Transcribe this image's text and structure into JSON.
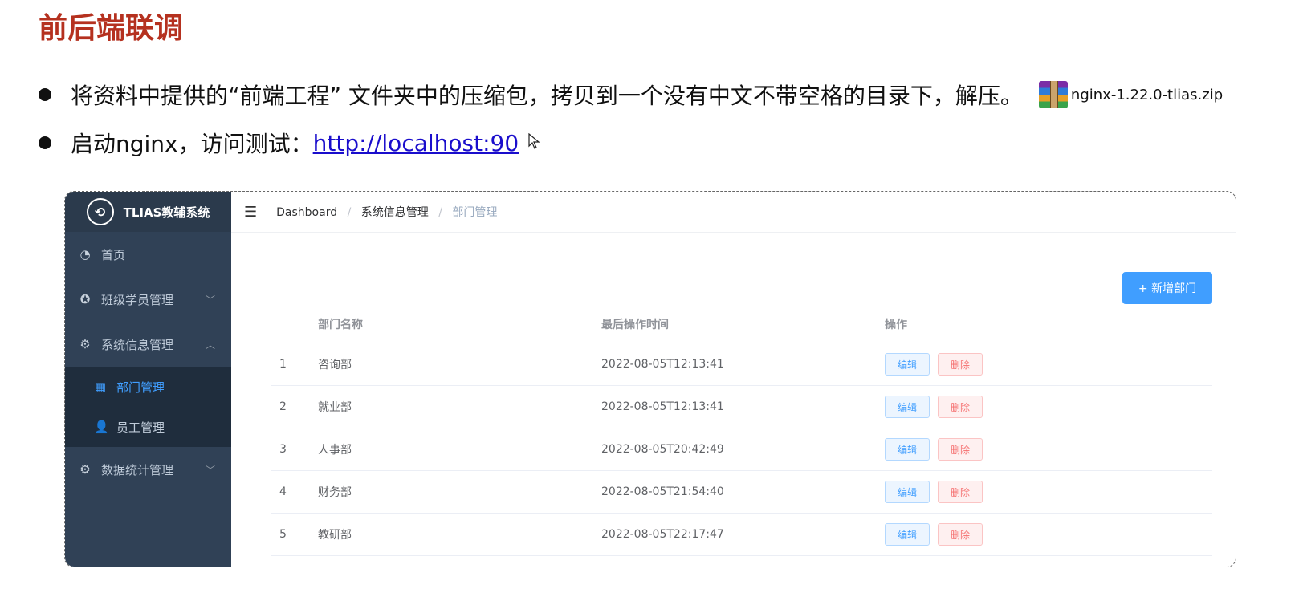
{
  "slide": {
    "title": "前后端联调",
    "bullet1": "将资料中提供的“前端工程” 文件夹中的压缩包，拷贝到一个没有中文不带空格的目录下，解压。",
    "zip_filename": "nginx-1.22.0-tlias.zip",
    "bullet2_prefix": "启动nginx，访问测试：",
    "bullet2_link": "http://localhost:90"
  },
  "app": {
    "brand": "TLIAS教辅系统",
    "menu": {
      "home": "首页",
      "class_mgmt": "班级学员管理",
      "system_mgmt": "系统信息管理",
      "dept_mgmt": "部门管理",
      "emp_mgmt": "员工管理",
      "stats_mgmt": "数据统计管理"
    },
    "breadcrumb": {
      "root": "Dashboard",
      "mid": "系统信息管理",
      "current": "部门管理",
      "separator": "/"
    },
    "add_button": "+ 新增部门",
    "table": {
      "headers": {
        "name": "部门名称",
        "time": "最后操作时间",
        "ops": "操作"
      },
      "edit_label": "编辑",
      "delete_label": "删除",
      "rows": [
        {
          "idx": "1",
          "name": "咨询部",
          "time": "2022-08-05T12:13:41"
        },
        {
          "idx": "2",
          "name": "就业部",
          "time": "2022-08-05T12:13:41"
        },
        {
          "idx": "3",
          "name": "人事部",
          "time": "2022-08-05T20:42:49"
        },
        {
          "idx": "4",
          "name": "财务部",
          "time": "2022-08-05T21:54:40"
        },
        {
          "idx": "5",
          "name": "教研部",
          "time": "2022-08-05T22:17:47"
        }
      ]
    },
    "colors": {
      "accent": "#409eff",
      "sidebar": "#304156",
      "danger": "#f56c6c",
      "title": "#b5311f"
    }
  }
}
